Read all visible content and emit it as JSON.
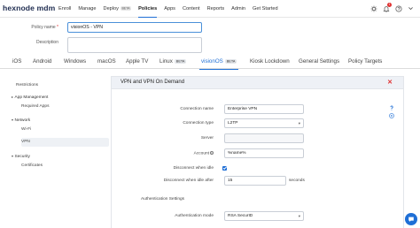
{
  "brand": {
    "logo_text": "hexnode mdm"
  },
  "nav": {
    "items": [
      {
        "label": "Enroll"
      },
      {
        "label": "Manage"
      },
      {
        "label": "Deploy",
        "badge": "BETA"
      },
      {
        "label": "Policies",
        "active": true
      },
      {
        "label": "Apps"
      },
      {
        "label": "Content"
      },
      {
        "label": "Reports"
      },
      {
        "label": "Admin"
      },
      {
        "label": "Get Started"
      }
    ],
    "notification_count": "1"
  },
  "policy": {
    "name_label": "Policy name",
    "name_required_mark": "*",
    "name_value": "visionOS - VPN",
    "description_label": "Description",
    "description_value": ""
  },
  "platform_tabs": [
    {
      "label": "iOS"
    },
    {
      "label": "Android"
    },
    {
      "label": "Windows"
    },
    {
      "label": "macOS"
    },
    {
      "label": "Apple TV"
    },
    {
      "label": "Linux",
      "badge": "BETA"
    },
    {
      "label": "visionOS",
      "badge": "BETA",
      "active": true
    },
    {
      "label": "Kiosk Lockdown"
    },
    {
      "label": "General Settings"
    },
    {
      "label": "Policy Targets"
    }
  ],
  "sidebar": {
    "restrictions": "Restrictions",
    "app_management": "App Management",
    "required_apps": "Required Apps",
    "network": "Network",
    "wifi": "Wi-Fi",
    "vpn": "VPN",
    "security": "Security",
    "certificates": "Certificates"
  },
  "panel": {
    "title": "VPN and VPN On Demand",
    "connection_name_label": "Connection name",
    "connection_name_value": "Enterprise VPN",
    "connection_type_label": "Connection type",
    "connection_type_value": "L2TP",
    "server_label": "Server",
    "server_value": "",
    "account_label": "Account",
    "account_value": "%name%",
    "disconnect_idle_label": "Disconnect when idle",
    "disconnect_idle_checked": true,
    "disconnect_after_label": "Disconnect when idle after",
    "disconnect_after_value": "15",
    "disconnect_after_unit": "seconds",
    "auth_section_label": "Authentication Settings",
    "auth_mode_label": "Authentication mode",
    "auth_mode_value": "RSA SecurID"
  },
  "colors": {
    "accent": "#1f6fd6",
    "danger": "#e02d2d",
    "brand": "#1d2b4f"
  }
}
